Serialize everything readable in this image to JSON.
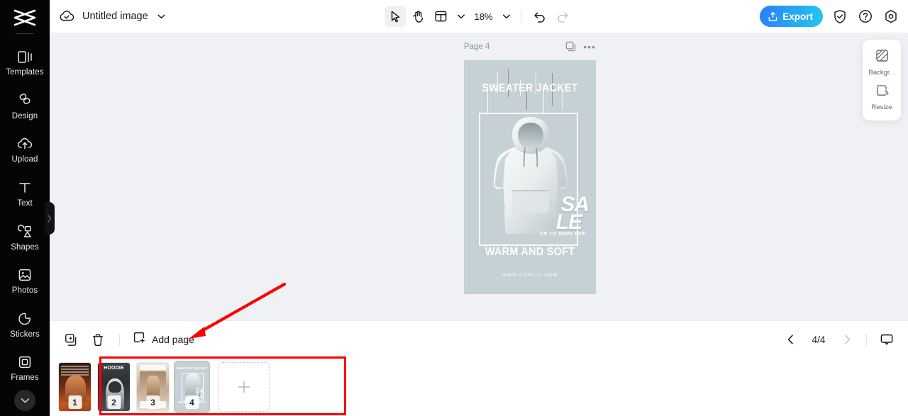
{
  "app": {
    "name": "CapCut",
    "logo_icon": "capcut-logo-icon"
  },
  "sidebar": {
    "items": [
      {
        "label": "Templates",
        "icon": "templates-icon"
      },
      {
        "label": "Design",
        "icon": "design-icon"
      },
      {
        "label": "Upload",
        "icon": "upload-cloud-icon"
      },
      {
        "label": "Text",
        "icon": "text-icon"
      },
      {
        "label": "Shapes",
        "icon": "shapes-icon"
      },
      {
        "label": "Photos",
        "icon": "photos-icon"
      },
      {
        "label": "Stickers",
        "icon": "stickers-icon"
      },
      {
        "label": "Frames",
        "icon": "frames-icon"
      }
    ],
    "more_button_icon": "chevron-down-icon",
    "collapse_handle_icon": "chevron-right-icon"
  },
  "topbar": {
    "cloud_icon": "cloud-saved-icon",
    "doc_title": "Untitled image",
    "title_caret_icon": "chevron-down-icon",
    "tools": [
      {
        "name": "select-tool",
        "icon": "cursor-arrow-icon",
        "active": true
      },
      {
        "name": "hand-tool",
        "icon": "hand-icon",
        "active": false
      },
      {
        "name": "layout-tool",
        "icon": "layout-panel-icon",
        "active": false
      }
    ],
    "layout_caret_icon": "chevron-down-icon",
    "zoom_value": "18%",
    "zoom_caret_icon": "chevron-down-icon",
    "undo_icon": "undo-arrow-icon",
    "redo_icon": "redo-arrow-icon",
    "export_label": "Export",
    "export_icon": "upload-box-icon",
    "export_color": "#2b7fff",
    "export_color_end": "#22c7ee",
    "right_icons": [
      {
        "name": "shield-check-icon"
      },
      {
        "name": "help-question-icon"
      },
      {
        "name": "settings-gear-icon"
      }
    ]
  },
  "canvas": {
    "background_color": "#eff1f4",
    "page_label": "Page 4",
    "duplicate_icon": "duplicate-page-icon",
    "more_icon": "more-options-icon",
    "poster": {
      "background_color": "#c5d1d4",
      "title": "SWEATER JACKET",
      "sale_line1": "SA",
      "sale_line2": "LE",
      "sale_sub": "UP TO 500% OFF",
      "tagline": "WARM AND SOFT",
      "website": "WWW.CAPCUT.COM"
    }
  },
  "right_panel": {
    "items": [
      {
        "label": "Backgr...",
        "icon": "background-pattern-icon"
      },
      {
        "label": "Resize",
        "icon": "resize-icon"
      }
    ]
  },
  "bottombar": {
    "duplicate_icon": "duplicate-icon",
    "delete_icon": "trash-icon",
    "add_page_label": "Add page",
    "add_page_icon": "add-page-icon",
    "prev_icon": "chevron-left-icon",
    "next_icon": "chevron-right-icon",
    "page_indicator": "4/4",
    "present_icon": "present-monitor-icon"
  },
  "pagestrip": {
    "thumbnails": [
      {
        "number": "1",
        "theme": "t1",
        "caption": ""
      },
      {
        "number": "2",
        "theme": "t2",
        "caption": "HOODIE"
      },
      {
        "number": "3",
        "theme": "t3",
        "caption": ""
      },
      {
        "number": "4",
        "theme": "t4",
        "caption": "",
        "selected": true
      }
    ],
    "add_thumb_icon": "plus-icon"
  },
  "annotation": {
    "arrow_color": "#ff0000",
    "highlight_color": "#ff0000",
    "arrow_target": "Add page"
  }
}
